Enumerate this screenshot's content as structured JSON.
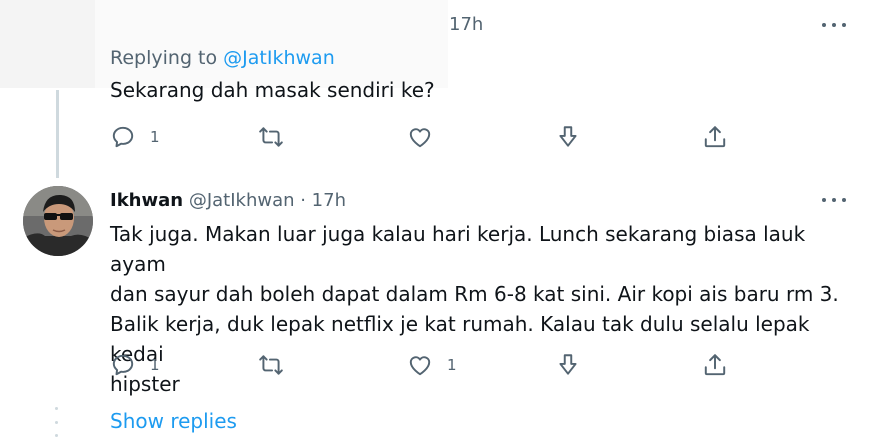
{
  "tweet_top": {
    "time": "17h",
    "replying_label": "Replying to",
    "replying_handle": "@JatIkhwan",
    "text": "Sekarang dah masak sendiri ke?",
    "reply_count": "1",
    "retweet_count": "",
    "like_count": ""
  },
  "tweet_reply": {
    "author_name": "Ikhwan",
    "author_meta": "@JatIkhwan · 17h",
    "text_lines": [
      "Tak juga. Makan luar juga kalau hari kerja. Lunch sekarang biasa lauk ayam",
      "dan sayur dah boleh dapat dalam Rm 6-8 kat sini. Air kopi ais baru rm 3.",
      "Balik kerja, duk lepak netflix je kat rumah. Kalau tak dulu selalu lepak kedai",
      "hipster"
    ],
    "reply_count": "1",
    "retweet_count": "",
    "like_count": "1"
  },
  "show_replies_label": "Show replies",
  "colors": {
    "accent": "#1d9bf0",
    "secondary_text": "#536471",
    "primary_text": "#0f1419",
    "thread_line": "#cfd9de"
  },
  "icons": [
    "reply-icon",
    "retweet-icon",
    "like-icon",
    "download-icon",
    "share-icon",
    "more-icon"
  ]
}
